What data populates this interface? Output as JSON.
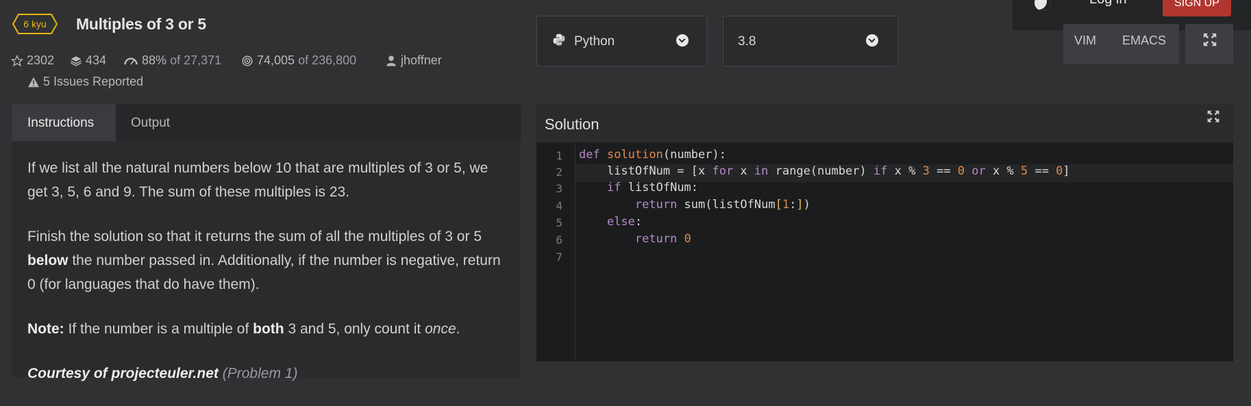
{
  "auth": {
    "login": "Log in",
    "signup": "SIGN UP"
  },
  "kata": {
    "rank": "6 kyu",
    "title": "Multiples of 3 or 5",
    "stars": "2302",
    "collections": "434",
    "satisfaction": "88%",
    "satisfaction_of": "of 27,371",
    "completed": "74,005",
    "completed_of": "of 236,800",
    "author": "jhoffner",
    "issues": "5 Issues Reported"
  },
  "language": {
    "selected": "Python",
    "version": "3.8"
  },
  "editor_modes": {
    "vim": "VIM",
    "emacs": "EMACS"
  },
  "tabs": {
    "instructions": "Instructions",
    "output": "Output"
  },
  "instructions": {
    "p1": "If we list all the natural numbers below 10 that are multiples of 3 or 5, we get 3, 5, 6 and 9. The sum of these multiples is 23.",
    "p2_a": "Finish the solution so that it returns the sum of all the multiples of 3 or 5 ",
    "p2_bold": "below",
    "p2_b": " the number passed in. Additionally, if the number is negative, return 0 (for languages that do have them).",
    "note_label": "Note:",
    "note_a": " If the number is a multiple of ",
    "note_bold": "both",
    "note_b": " 3 and 5, only count it ",
    "note_italic": "once",
    "note_end": ".",
    "courtesy": "Courtesy of projecteuler.net",
    "courtesy_ref": "(Problem 1)"
  },
  "solution": {
    "header": "Solution",
    "line_numbers": [
      "1",
      "2",
      "3",
      "4",
      "5",
      "6",
      "7"
    ]
  },
  "colors": {
    "accent_rank": "#ecb613",
    "signup": "#b1362f"
  }
}
